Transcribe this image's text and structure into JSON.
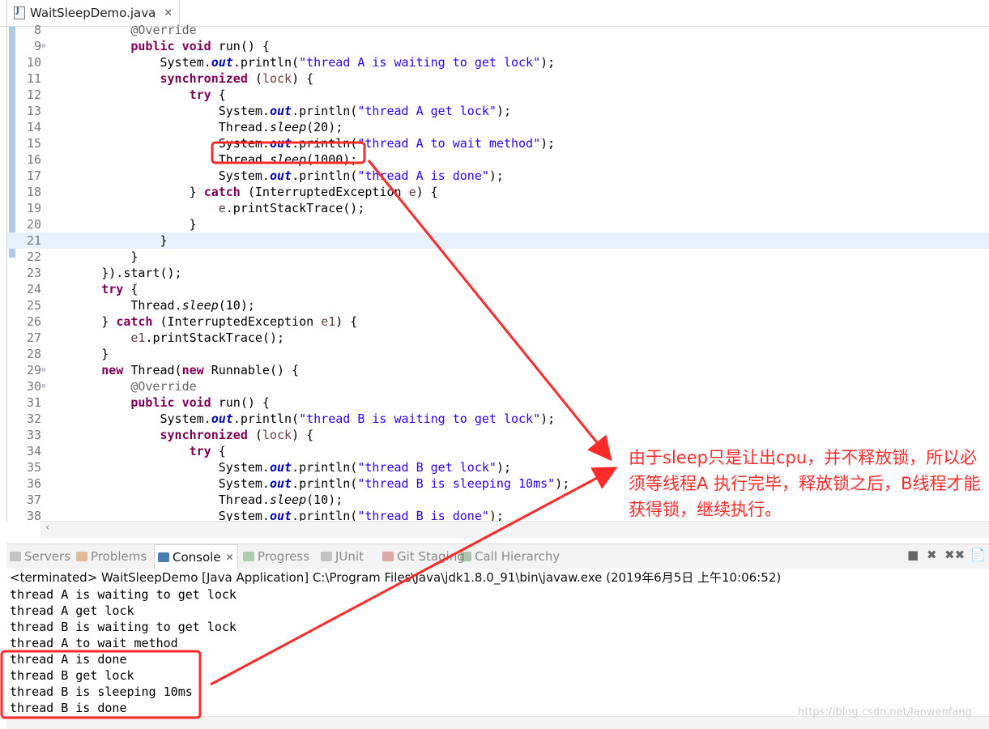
{
  "editor": {
    "tab_title": "WaitSleepDemo.java",
    "tab_close": "✕",
    "lines": [
      {
        "n": "8",
        "code": [
          {
            "t": "            "
          },
          {
            "t": "@Override",
            "c": "ann"
          }
        ]
      },
      {
        "n": "9",
        "fold": "⊖",
        "code": [
          {
            "t": "            "
          },
          {
            "t": "public",
            "c": "kw"
          },
          {
            "t": " "
          },
          {
            "t": "void",
            "c": "kw"
          },
          {
            "t": " run() {"
          }
        ]
      },
      {
        "n": "10",
        "code": [
          {
            "t": "                System."
          },
          {
            "t": "out",
            "c": "fld"
          },
          {
            "t": ".println("
          },
          {
            "t": "\"thread A is waiting to get lock\"",
            "c": "str"
          },
          {
            "t": ");"
          }
        ]
      },
      {
        "n": "11",
        "code": [
          {
            "t": "                "
          },
          {
            "t": "synchronized",
            "c": "kw"
          },
          {
            "t": " ("
          },
          {
            "t": "lock",
            "c": "var"
          },
          {
            "t": ") {"
          }
        ]
      },
      {
        "n": "12",
        "code": [
          {
            "t": "                    "
          },
          {
            "t": "try",
            "c": "kw"
          },
          {
            "t": " {"
          }
        ]
      },
      {
        "n": "13",
        "code": [
          {
            "t": "                        System."
          },
          {
            "t": "out",
            "c": "fld"
          },
          {
            "t": ".println("
          },
          {
            "t": "\"thread A get lock\"",
            "c": "str"
          },
          {
            "t": ");"
          }
        ]
      },
      {
        "n": "14",
        "code": [
          {
            "t": "                        Thread."
          },
          {
            "t": "sleep",
            "c": "ital"
          },
          {
            "t": "(20);"
          }
        ]
      },
      {
        "n": "15",
        "code": [
          {
            "t": "                        System."
          },
          {
            "t": "out",
            "c": "fld"
          },
          {
            "t": ".println("
          },
          {
            "t": "\"thread A to wait method\"",
            "c": "str"
          },
          {
            "t": ");"
          }
        ]
      },
      {
        "n": "16",
        "code": [
          {
            "t": "                        Thread."
          },
          {
            "t": "sleep",
            "c": "ital"
          },
          {
            "t": "(1000);"
          }
        ]
      },
      {
        "n": "17",
        "code": [
          {
            "t": "                        System."
          },
          {
            "t": "out",
            "c": "fld"
          },
          {
            "t": ".println("
          },
          {
            "t": "\"thread A is done\"",
            "c": "str"
          },
          {
            "t": ");"
          }
        ]
      },
      {
        "n": "18",
        "code": [
          {
            "t": "                    } "
          },
          {
            "t": "catch",
            "c": "kw"
          },
          {
            "t": " (InterruptedException "
          },
          {
            "t": "e",
            "c": "var"
          },
          {
            "t": ") {"
          }
        ]
      },
      {
        "n": "19",
        "code": [
          {
            "t": "                        "
          },
          {
            "t": "e",
            "c": "var"
          },
          {
            "t": ".printStackTrace();"
          }
        ]
      },
      {
        "n": "20",
        "code": [
          {
            "t": "                    }"
          }
        ]
      },
      {
        "n": "21",
        "current": true,
        "code": [
          {
            "t": "                }"
          }
        ]
      },
      {
        "n": "22",
        "code": [
          {
            "t": "            }"
          }
        ]
      },
      {
        "n": "23",
        "code": [
          {
            "t": "        }).start();"
          }
        ]
      },
      {
        "n": "24",
        "code": [
          {
            "t": "        "
          },
          {
            "t": "try",
            "c": "kw"
          },
          {
            "t": " {"
          }
        ]
      },
      {
        "n": "25",
        "code": [
          {
            "t": "            Thread."
          },
          {
            "t": "sleep",
            "c": "ital"
          },
          {
            "t": "(10);"
          }
        ]
      },
      {
        "n": "26",
        "code": [
          {
            "t": "        } "
          },
          {
            "t": "catch",
            "c": "kw"
          },
          {
            "t": " (InterruptedException "
          },
          {
            "t": "e1",
            "c": "var"
          },
          {
            "t": ") {"
          }
        ]
      },
      {
        "n": "27",
        "code": [
          {
            "t": "            "
          },
          {
            "t": "e1",
            "c": "var"
          },
          {
            "t": ".printStackTrace();"
          }
        ]
      },
      {
        "n": "28",
        "code": [
          {
            "t": "        }"
          }
        ]
      },
      {
        "n": "29",
        "fold": "⊖",
        "code": [
          {
            "t": "        "
          },
          {
            "t": "new",
            "c": "kw"
          },
          {
            "t": " Thread("
          },
          {
            "t": "new",
            "c": "kw"
          },
          {
            "t": " Runnable() {"
          }
        ]
      },
      {
        "n": "30",
        "fold": "⊖",
        "code": [
          {
            "t": "            "
          },
          {
            "t": "@Override",
            "c": "ann"
          }
        ]
      },
      {
        "n": "31",
        "code": [
          {
            "t": "            "
          },
          {
            "t": "public",
            "c": "kw"
          },
          {
            "t": " "
          },
          {
            "t": "void",
            "c": "kw"
          },
          {
            "t": " run() {"
          }
        ]
      },
      {
        "n": "32",
        "code": [
          {
            "t": "                System."
          },
          {
            "t": "out",
            "c": "fld"
          },
          {
            "t": ".println("
          },
          {
            "t": "\"thread B is waiting to get lock\"",
            "c": "str"
          },
          {
            "t": ");"
          }
        ]
      },
      {
        "n": "33",
        "code": [
          {
            "t": "                "
          },
          {
            "t": "synchronized",
            "c": "kw"
          },
          {
            "t": " ("
          },
          {
            "t": "lock",
            "c": "var"
          },
          {
            "t": ") {"
          }
        ]
      },
      {
        "n": "34",
        "code": [
          {
            "t": "                    "
          },
          {
            "t": "try",
            "c": "kw"
          },
          {
            "t": " {"
          }
        ]
      },
      {
        "n": "35",
        "code": [
          {
            "t": "                        System."
          },
          {
            "t": "out",
            "c": "fld"
          },
          {
            "t": ".println("
          },
          {
            "t": "\"thread B get lock\"",
            "c": "str"
          },
          {
            "t": ");"
          }
        ]
      },
      {
        "n": "36",
        "code": [
          {
            "t": "                        System."
          },
          {
            "t": "out",
            "c": "fld"
          },
          {
            "t": ".println("
          },
          {
            "t": "\"thread B is sleeping 10ms\"",
            "c": "str"
          },
          {
            "t": ");"
          }
        ]
      },
      {
        "n": "37",
        "code": [
          {
            "t": "                        Thread."
          },
          {
            "t": "sleep",
            "c": "ital"
          },
          {
            "t": "(10);"
          }
        ]
      },
      {
        "n": "38",
        "code": [
          {
            "t": "                        System."
          },
          {
            "t": "out",
            "c": "fld"
          },
          {
            "t": ".println("
          },
          {
            "t": "\"thread B is done\"",
            "c": "str"
          },
          {
            "t": ");"
          }
        ]
      }
    ]
  },
  "views": {
    "tabs": [
      {
        "label": "Servers",
        "icon": "servers-icon",
        "color": "#8a8a8a"
      },
      {
        "label": "Problems",
        "icon": "problems-icon",
        "color": "#c07a30"
      },
      {
        "label": "Console",
        "icon": "console-icon",
        "color": "#3a6ea5",
        "active": true
      },
      {
        "label": "Progress",
        "icon": "progress-icon",
        "color": "#5aa05a"
      },
      {
        "label": "JUnit",
        "icon": "junit-icon",
        "color": "#8a8a8a"
      },
      {
        "label": "Git Staging",
        "icon": "git-staging-icon",
        "color": "#c05050"
      },
      {
        "label": "Call Hierarchy",
        "icon": "call-hierarchy-icon",
        "color": "#5a8a5a"
      }
    ],
    "console_close": "✕",
    "toolbar": {
      "stop": "■",
      "remove": "✖",
      "remove_all": "✖✖",
      "pin": "📄"
    }
  },
  "console": {
    "header": "<terminated> WaitSleepDemo [Java Application] C:\\Program Files\\Java\\jdk1.8.0_91\\bin\\javaw.exe (2019年6月5日 上午10:06:52)",
    "lines": [
      "thread A is waiting to get lock",
      "thread A get lock",
      "thread B is waiting to get lock",
      "thread A to wait method",
      "thread A is done",
      "thread B get lock",
      "thread B is sleeping 10ms",
      "thread B is done"
    ]
  },
  "annotation": {
    "text": "由于sleep只是让出cpu，并不释放锁，所以必须等线程A 执行完毕，释放锁之后，B线程才能获得锁，继续执行。",
    "color": "#ff2a2a"
  },
  "watermark": "https://blog.csdn.net/lanwenfang"
}
